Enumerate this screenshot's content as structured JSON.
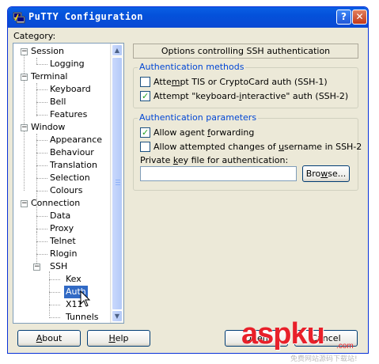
{
  "window": {
    "title": "PuTTY Configuration",
    "help_glyph": "?",
    "close_glyph": "✕"
  },
  "category_label": "Category:",
  "tree": {
    "session": "Session",
    "logging": "Logging",
    "terminal": "Terminal",
    "keyboard": "Keyboard",
    "bell": "Bell",
    "features": "Features",
    "window": "Window",
    "appearance": "Appearance",
    "behaviour": "Behaviour",
    "translation": "Translation",
    "selection": "Selection",
    "colours": "Colours",
    "connection": "Connection",
    "data": "Data",
    "proxy": "Proxy",
    "telnet": "Telnet",
    "rlogin": "Rlogin",
    "ssh": "SSH",
    "kex": "Kex",
    "auth": "Auth",
    "x11": "X11",
    "tunnels": "Tunnels",
    "selected": "Auth"
  },
  "panel": {
    "title": "Options controlling SSH authentication",
    "methods": {
      "title": "Authentication methods",
      "tis": {
        "pre": "Atte",
        "u": "m",
        "post": "pt TIS or CryptoCard auth (SSH-1)",
        "checked": false
      },
      "ki": {
        "pre": "Attempt \"keyboard-",
        "u": "i",
        "post": "nteractive\" auth (SSH-2)",
        "checked": true
      }
    },
    "params": {
      "title": "Authentication parameters",
      "agent_fwd": {
        "pre": "Allow agent ",
        "u": "f",
        "post": "orwarding",
        "checked": true
      },
      "username_change": {
        "pre": "Allow attempted changes of ",
        "u": "u",
        "post": "sername in SSH-2",
        "checked": false
      },
      "key_label": {
        "pre": "Private ",
        "u": "k",
        "post": "ey file for authentication:"
      },
      "key_value": "",
      "browse": {
        "pre": "Bro",
        "u": "w",
        "post": "se..."
      }
    }
  },
  "buttons": {
    "about": {
      "u": "A",
      "post": "bout"
    },
    "help": {
      "u": "H",
      "post": "elp"
    },
    "open": "Open",
    "cancel": "Cancel"
  },
  "watermark": {
    "logo": "aspku",
    "domain": ".com",
    "subtitle": "免费网站源码下载站!"
  },
  "colors": {
    "title_bar": "#0a5fe4",
    "selection": "#316ac5",
    "group_title": "#0046d5",
    "watermark": "#e8202a"
  }
}
